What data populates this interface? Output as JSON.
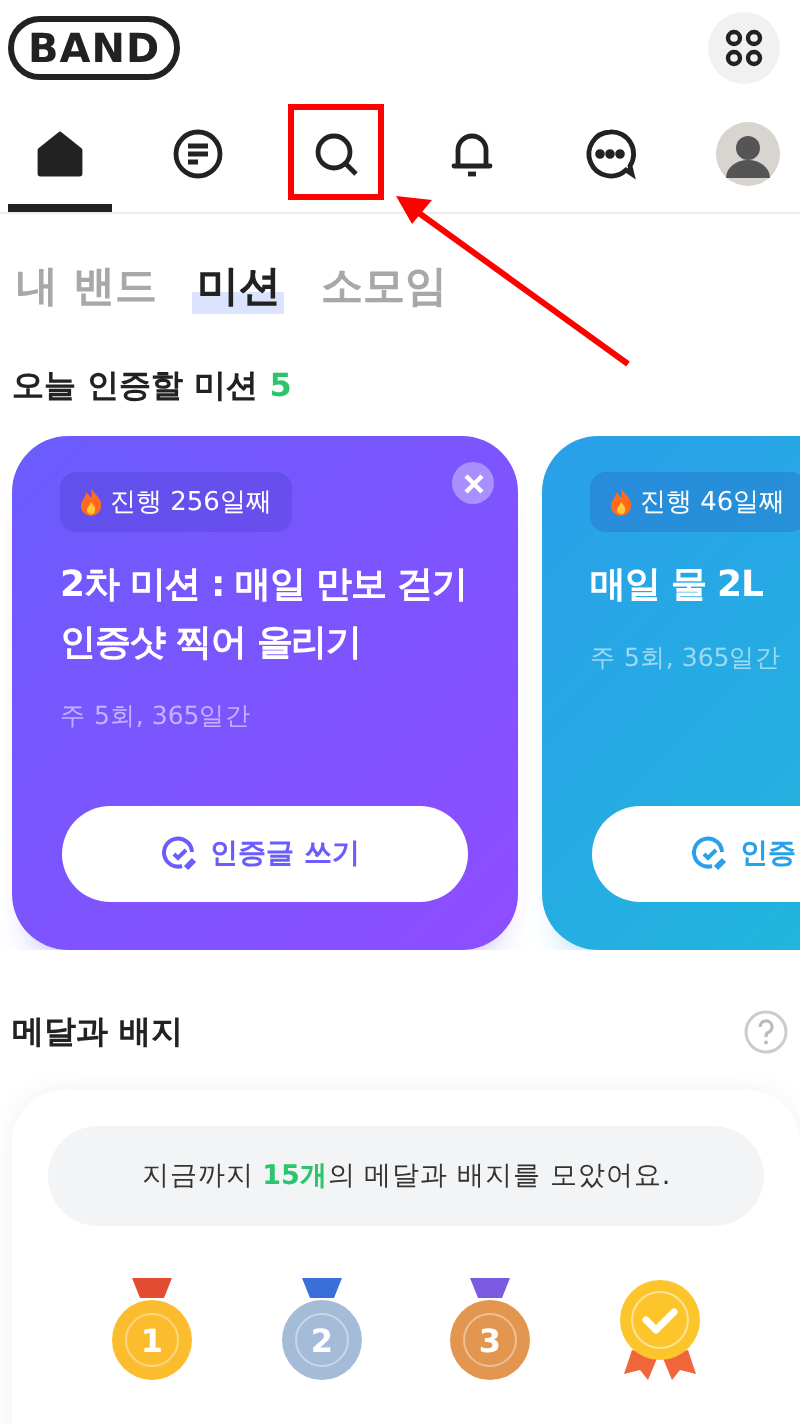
{
  "header": {
    "logo": "BAND"
  },
  "nav": [
    {
      "kind": "home",
      "selected": true,
      "highlighted": false
    },
    {
      "kind": "feed",
      "selected": false,
      "highlighted": false
    },
    {
      "kind": "search",
      "selected": false,
      "highlighted": true
    },
    {
      "kind": "bell",
      "selected": false,
      "highlighted": false
    },
    {
      "kind": "chat",
      "selected": false,
      "highlighted": false
    },
    {
      "kind": "avatar",
      "selected": false,
      "highlighted": false
    }
  ],
  "segments": [
    {
      "label": "내 밴드",
      "selected": false
    },
    {
      "label": "미션",
      "selected": true
    },
    {
      "label": "소모임",
      "selected": false
    }
  ],
  "missions_heading": {
    "label": "오늘 인증할 미션",
    "count": "5"
  },
  "missions": [
    {
      "streak": "진행 256일째",
      "title": "2차 미션 : 매일 만보 걷기 인증샷 찍어 올리기",
      "schedule": "주 5회, 365일간",
      "button": "인증글 쓰기",
      "closable": true,
      "color": "#6b5cfd"
    },
    {
      "streak": "진행 46일째",
      "title": "매일 물 2L",
      "schedule": "주 5회, 365일간",
      "button": "인증",
      "closable": false,
      "color": "#2a9fea"
    }
  ],
  "medals_section": {
    "title": "메달과 배지",
    "summary_before": "지금까지 ",
    "summary_highlight": "15개",
    "summary_after": "의 메달과 배지를 모았어요."
  },
  "medals": [
    {
      "kind": "medal",
      "label": "1",
      "color": "#fbbd2e"
    },
    {
      "kind": "medal",
      "label": "2",
      "color": "#a5bcd8"
    },
    {
      "kind": "medal",
      "label": "3",
      "color": "#e2964f"
    },
    {
      "kind": "badge",
      "color": "#fcc52c"
    }
  ]
}
